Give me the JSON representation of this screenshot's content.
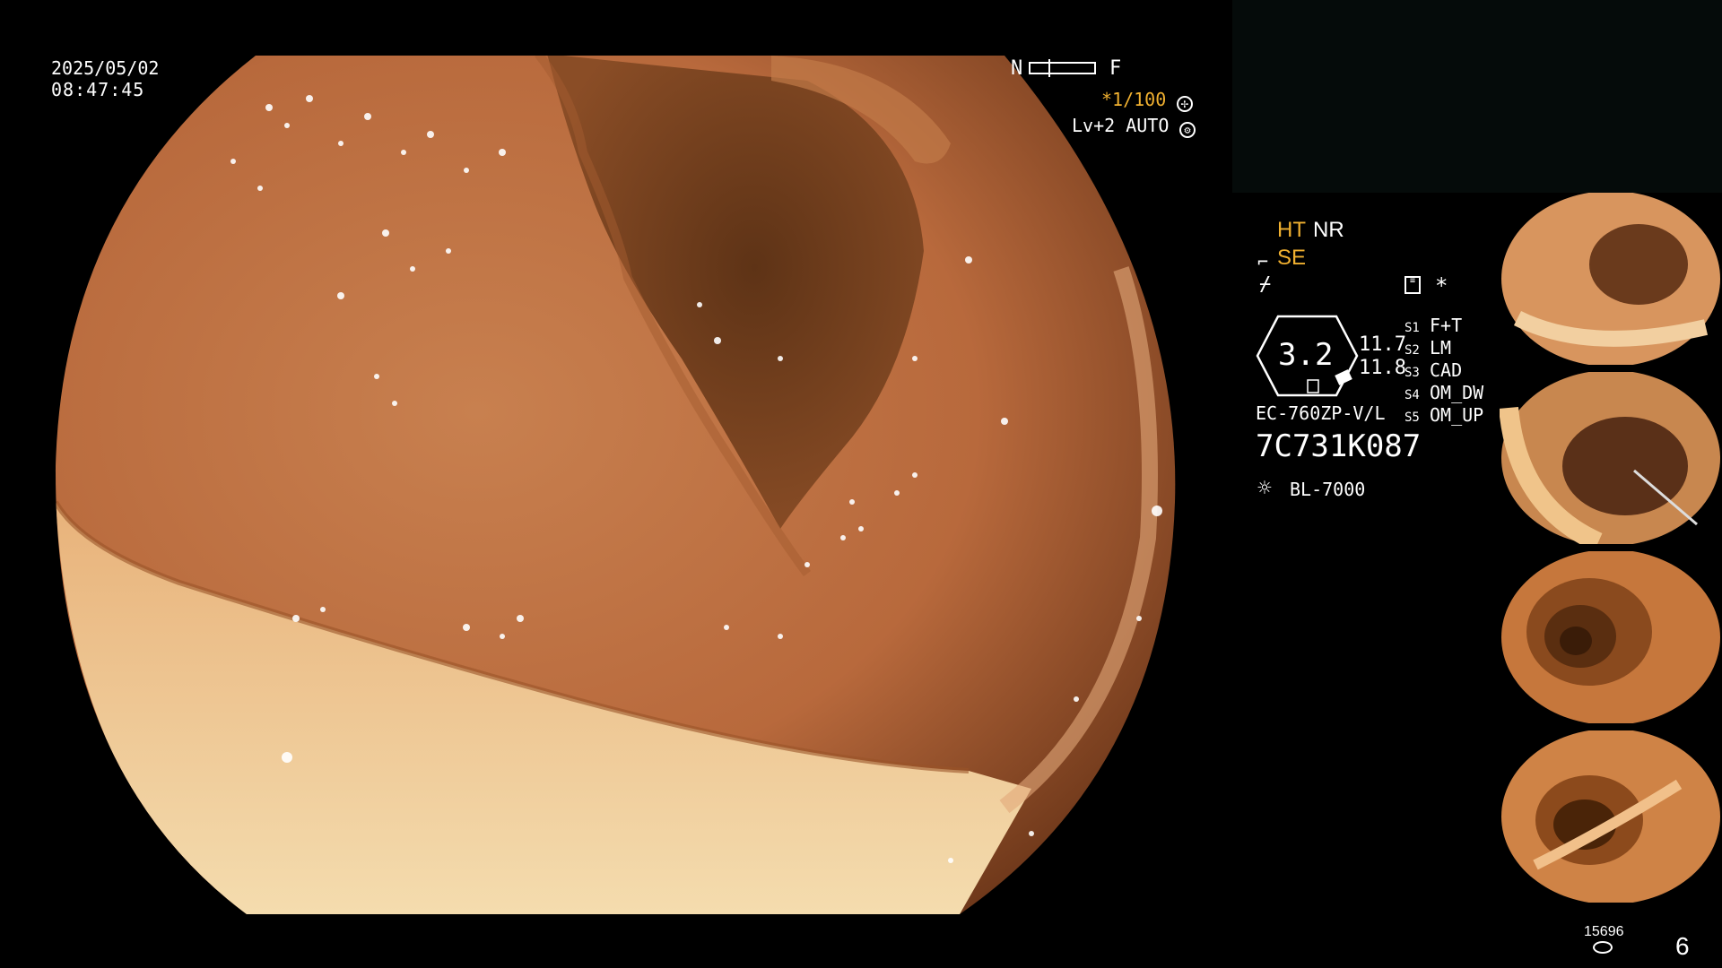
{
  "overlay": {
    "date": "2025/05/02",
    "time": "08:47:45",
    "nf_left": "N",
    "nf_right": "F",
    "shutter": "*1/100",
    "level": "Lv+2 AUTO"
  },
  "settings": {
    "ht": "HT",
    "nr": "NR",
    "se": "SE",
    "star": "*",
    "zoom_value": "3.2",
    "val1": "11.7",
    "val2": "11.8",
    "scope_model": "EC-760ZP-V/L",
    "serial": "7C731K087",
    "light": "BL-7000"
  },
  "switches": [
    {
      "key": "S1",
      "label": "F+T"
    },
    {
      "key": "S2",
      "label": "LM"
    },
    {
      "key": "S3",
      "label": "CAD"
    },
    {
      "key": "S4",
      "label": "OM_DW"
    },
    {
      "key": "S5",
      "label": "OM_UP"
    }
  ],
  "counter": {
    "images": "15696",
    "page": "6"
  },
  "colors": {
    "accent": "#f0b030",
    "background": "#000000"
  },
  "icons": [
    "fan-icon",
    "gear-icon",
    "scope-icon",
    "zigzag-icon",
    "memo-icon",
    "light-icon",
    "disk-icon"
  ]
}
